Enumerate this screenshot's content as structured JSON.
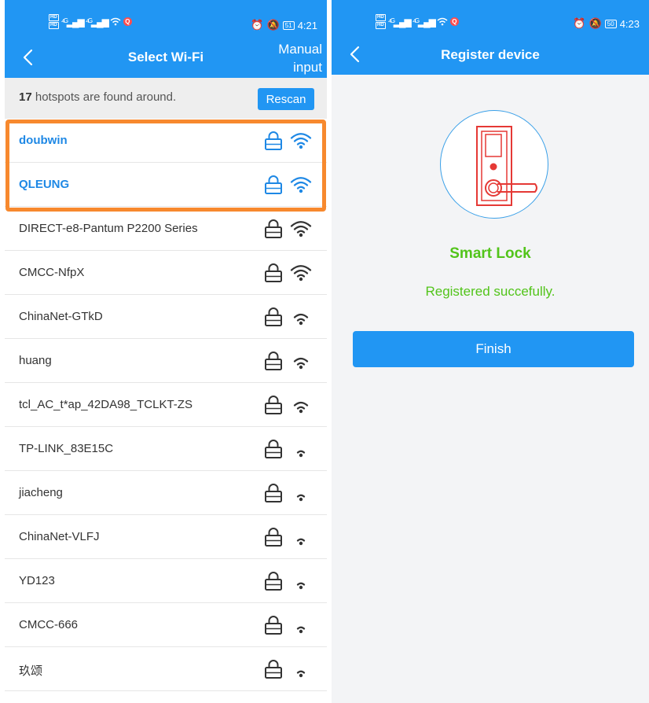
{
  "left_screen": {
    "status": {
      "time": "4:21",
      "battery": "51"
    },
    "title": "Select Wi-Fi",
    "manual_input": "Manual input",
    "found": {
      "count": "17",
      "text": " hotspots are found around."
    },
    "rescan_label": "Rescan",
    "networks": [
      {
        "name": "doubwin",
        "signal": "strong",
        "highlighted": true
      },
      {
        "name": "QLEUNG",
        "signal": "strong",
        "highlighted": true
      },
      {
        "name": "DIRECT-e8-Pantum P2200 Series",
        "signal": "strong",
        "highlighted": false
      },
      {
        "name": "CMCC-NfpX",
        "signal": "strong",
        "highlighted": false
      },
      {
        "name": "ChinaNet-GTkD",
        "signal": "medium",
        "highlighted": false
      },
      {
        "name": "huang",
        "signal": "medium",
        "highlighted": false
      },
      {
        "name": "tcl_AC_t*ap_42DA98_TCLKT-ZS",
        "signal": "medium",
        "highlighted": false
      },
      {
        "name": "TP-LINK_83E15C",
        "signal": "weak",
        "highlighted": false
      },
      {
        "name": "jiacheng",
        "signal": "weak",
        "highlighted": false
      },
      {
        "name": "ChinaNet-VLFJ",
        "signal": "weak",
        "highlighted": false
      },
      {
        "name": "YD123",
        "signal": "weak",
        "highlighted": false
      },
      {
        "name": "CMCC-666",
        "signal": "weak",
        "highlighted": false
      },
      {
        "name": "玖颂",
        "signal": "weak",
        "highlighted": false
      },
      {
        "name": "",
        "signal": "weak",
        "highlighted": false
      }
    ]
  },
  "right_screen": {
    "status": {
      "time": "4:23",
      "battery": "50"
    },
    "title": "Register device",
    "device_name": "Smart Lock",
    "success_message": "Registered succefully.",
    "finish_label": "Finish"
  },
  "colors": {
    "primary": "#2196f3",
    "highlight_border": "#f7892e",
    "success": "#52c41a",
    "lock_red": "#e53935",
    "highlight_text": "#1e88e5"
  },
  "icons": [
    "back-arrow-icon",
    "lock-icon",
    "wifi-icon",
    "smart-lock-icon"
  ]
}
